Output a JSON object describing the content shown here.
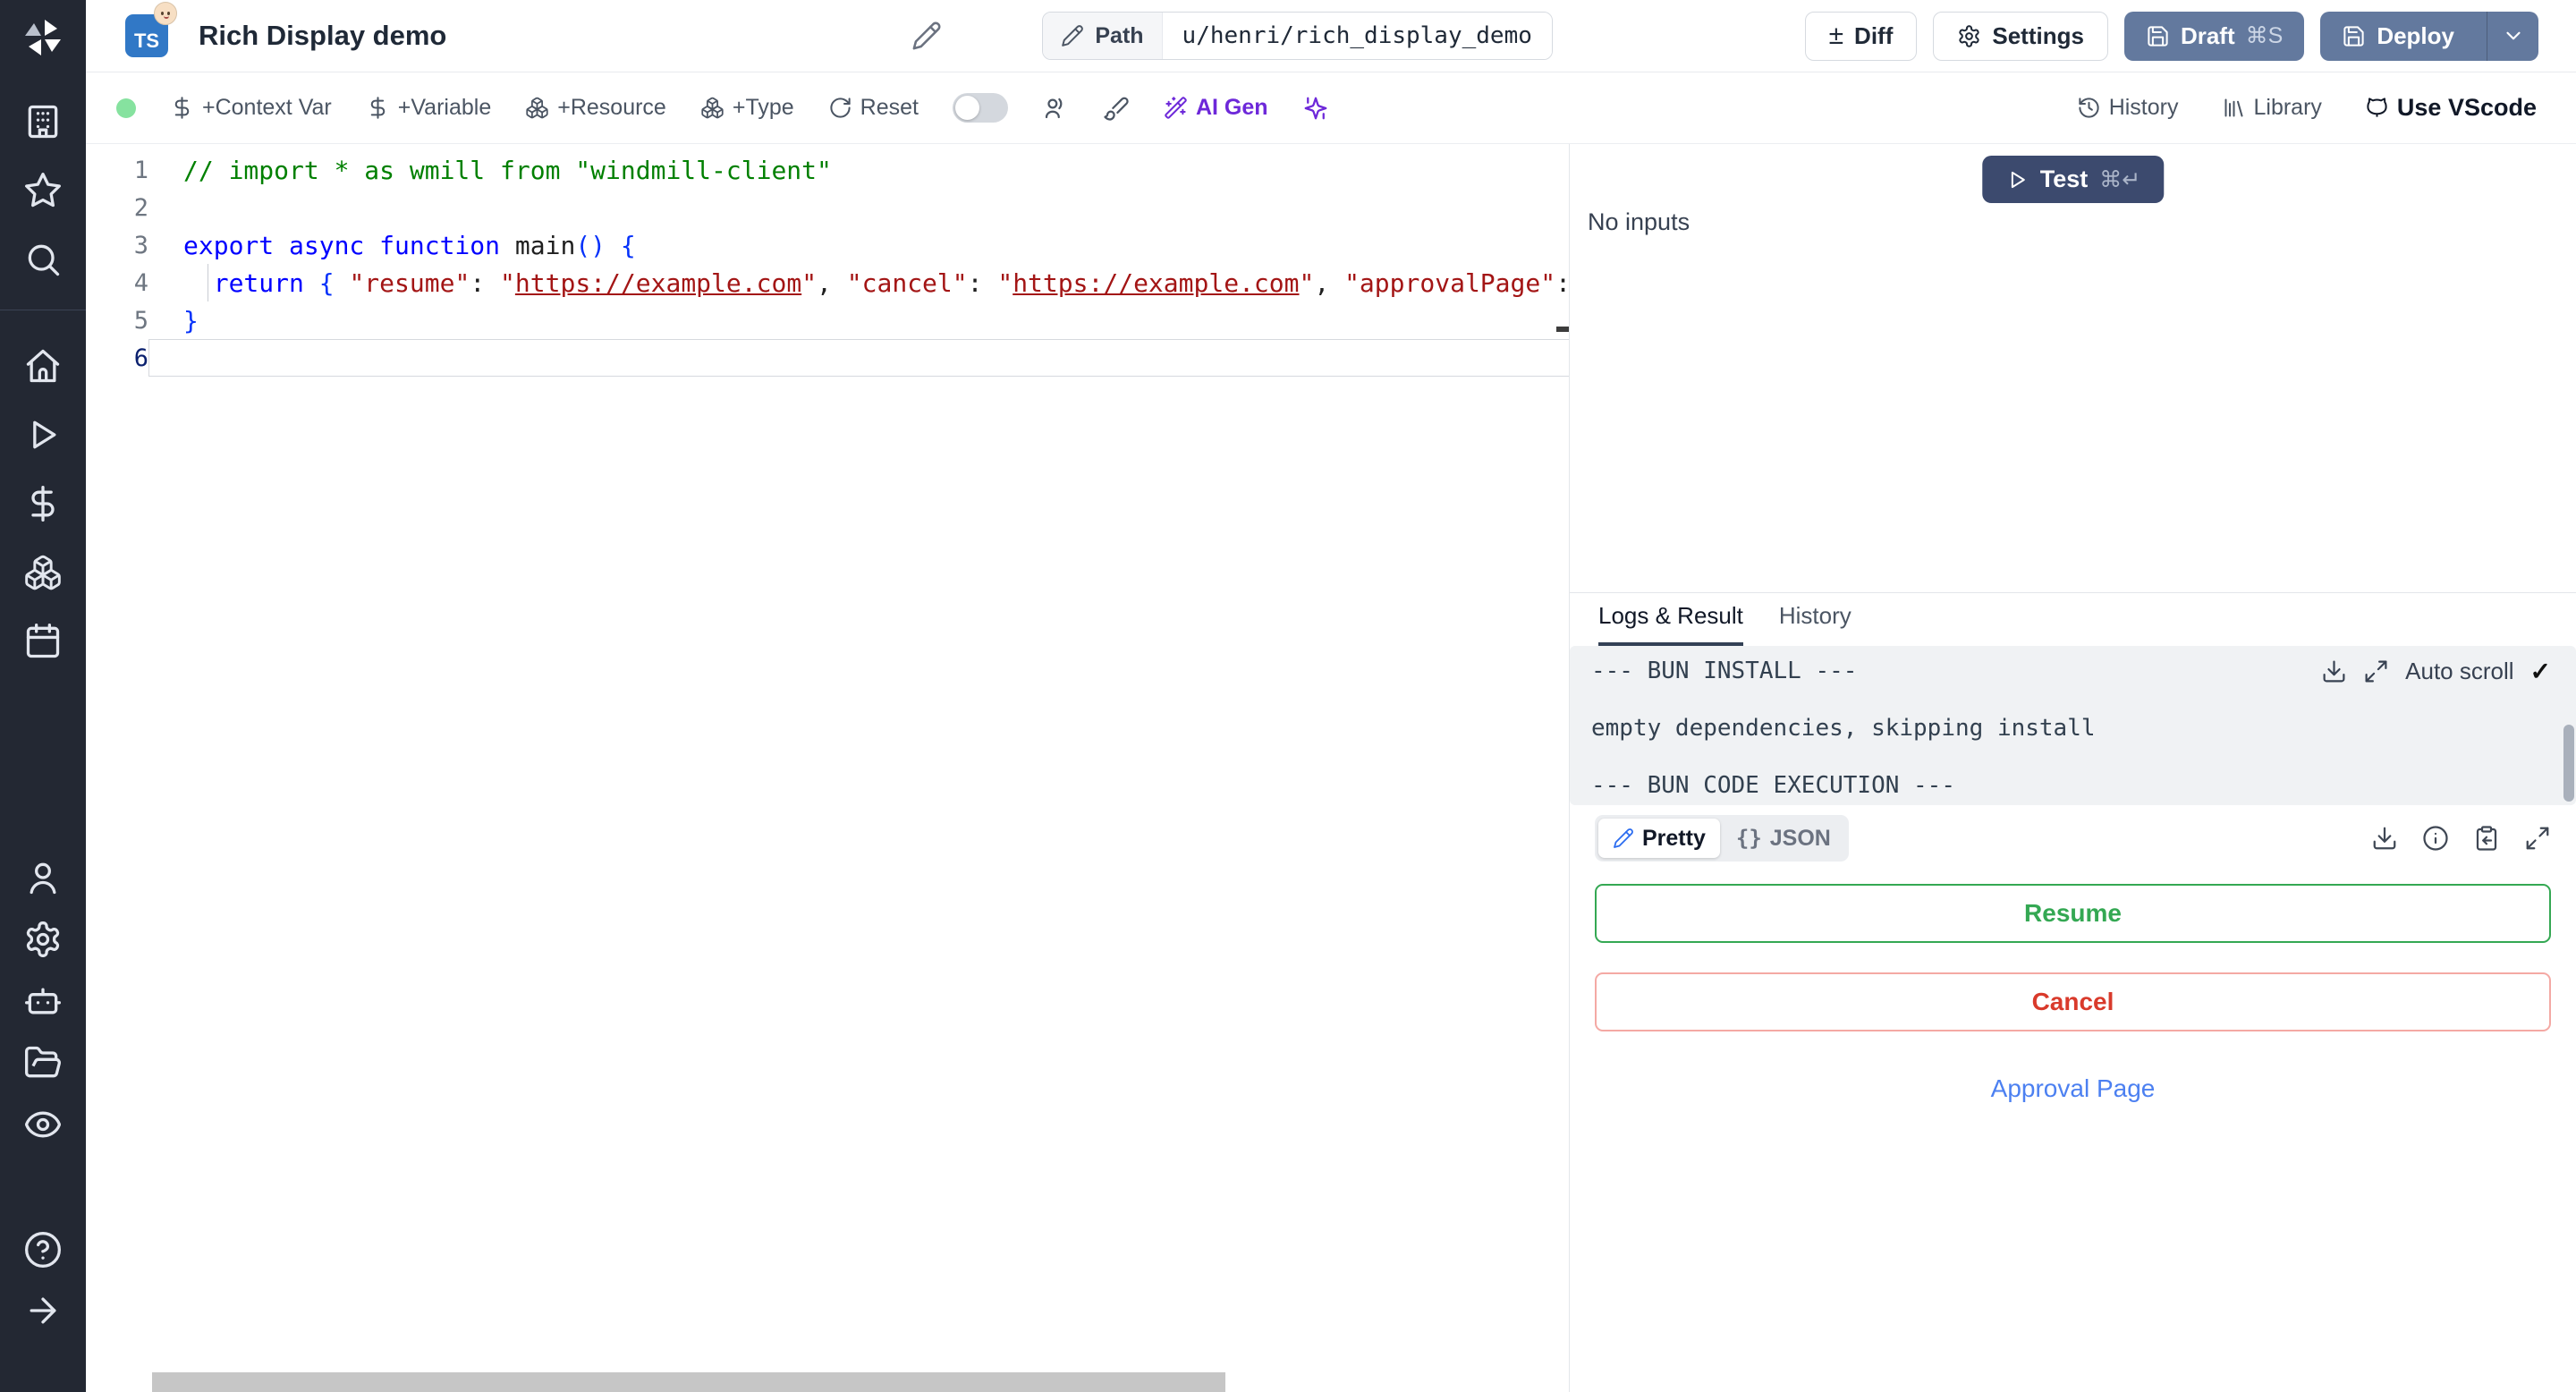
{
  "header": {
    "title": "Rich Display demo",
    "lang_badge": "TS",
    "path": {
      "label": "Path",
      "value": "u/henri/rich_display_demo"
    },
    "buttons": {
      "diff": "Diff",
      "settings": "Settings",
      "draft": "Draft",
      "draft_shortcut": "⌘S",
      "deploy": "Deploy"
    }
  },
  "toolbar": {
    "context_var": "+Context Var",
    "variable": "+Variable",
    "resource": "+Resource",
    "type": "+Type",
    "reset": "Reset",
    "ai_gen": "AI Gen",
    "right": {
      "history": "History",
      "library": "Library",
      "vscode": "Use VScode"
    }
  },
  "editor": {
    "lines": [
      {
        "n": 1,
        "tokens": [
          {
            "t": "// import * as wmill from \"windmill-client\"",
            "c": "comment"
          }
        ]
      },
      {
        "n": 2,
        "tokens": []
      },
      {
        "n": 3,
        "tokens": [
          {
            "t": "export async function",
            "c": "kw"
          },
          {
            "t": " main",
            "c": "plain"
          },
          {
            "t": "() {",
            "c": "bracket"
          }
        ]
      },
      {
        "n": 4,
        "guide": true,
        "tokens": [
          {
            "t": "  ",
            "c": "plain"
          },
          {
            "t": "return",
            "c": "kw"
          },
          {
            "t": " ",
            "c": "plain"
          },
          {
            "t": "{",
            "c": "bracket"
          },
          {
            "t": " ",
            "c": "plain"
          },
          {
            "t": "\"resume\"",
            "c": "str"
          },
          {
            "t": ": ",
            "c": "plain"
          },
          {
            "t": "\"",
            "c": "str"
          },
          {
            "t": "https://example.com",
            "c": "link"
          },
          {
            "t": "\"",
            "c": "str"
          },
          {
            "t": ", ",
            "c": "plain"
          },
          {
            "t": "\"cancel\"",
            "c": "str"
          },
          {
            "t": ": ",
            "c": "plain"
          },
          {
            "t": "\"",
            "c": "str"
          },
          {
            "t": "https://example.com",
            "c": "link"
          },
          {
            "t": "\"",
            "c": "str"
          },
          {
            "t": ", ",
            "c": "plain"
          },
          {
            "t": "\"approvalPage\"",
            "c": "str"
          },
          {
            "t": ":",
            "c": "plain"
          }
        ]
      },
      {
        "n": 5,
        "tokens": [
          {
            "t": "}",
            "c": "bracket"
          }
        ]
      },
      {
        "n": 6,
        "active": true,
        "tokens": []
      }
    ]
  },
  "runner": {
    "test": "Test",
    "test_shortcut": "⌘↵",
    "no_inputs": "No inputs",
    "tabs": {
      "logs_result": "Logs & Result",
      "history": "History"
    },
    "logs": [
      "--- BUN INSTALL ---",
      "",
      "empty dependencies, skipping install",
      "",
      "--- BUN CODE EXECUTION ---"
    ],
    "auto_scroll": "Auto scroll",
    "auto_scroll_check": "✓",
    "view": {
      "pretty": "Pretty",
      "json": "JSON",
      "json_braces": "{}"
    },
    "result": {
      "resume": "Resume",
      "cancel": "Cancel",
      "approval": "Approval Page"
    }
  },
  "sidebar_icons": [
    "windmill-logo",
    "building",
    "star",
    "search",
    "home",
    "play",
    "dollar",
    "boxes",
    "calendar",
    "user",
    "gear",
    "robot",
    "folder",
    "eye",
    "help",
    "arrow-right"
  ],
  "colors": {
    "ui": {
      "deploy-bg": "#63799e",
      "test-bg": "#3c4a6e",
      "sidebar-bg": "#232833",
      "status-dot": "#86e29f",
      "resume-green": "#34a853",
      "cancel-red": "#d93a2b",
      "cancel-border": "#f4a9a4",
      "link-blue": "#4c80f1",
      "ai-purple": "#6d28d9",
      "tab-underline": "#334155"
    },
    "syntax": {
      "comment": "#008000",
      "kw": "#0000ff",
      "str": "#a31515",
      "link": "#a31515",
      "bracket": "#0431fa",
      "plain": "#1f1f1f",
      "lineno": "#6e7681",
      "lineno_active": "#0b216f"
    }
  }
}
